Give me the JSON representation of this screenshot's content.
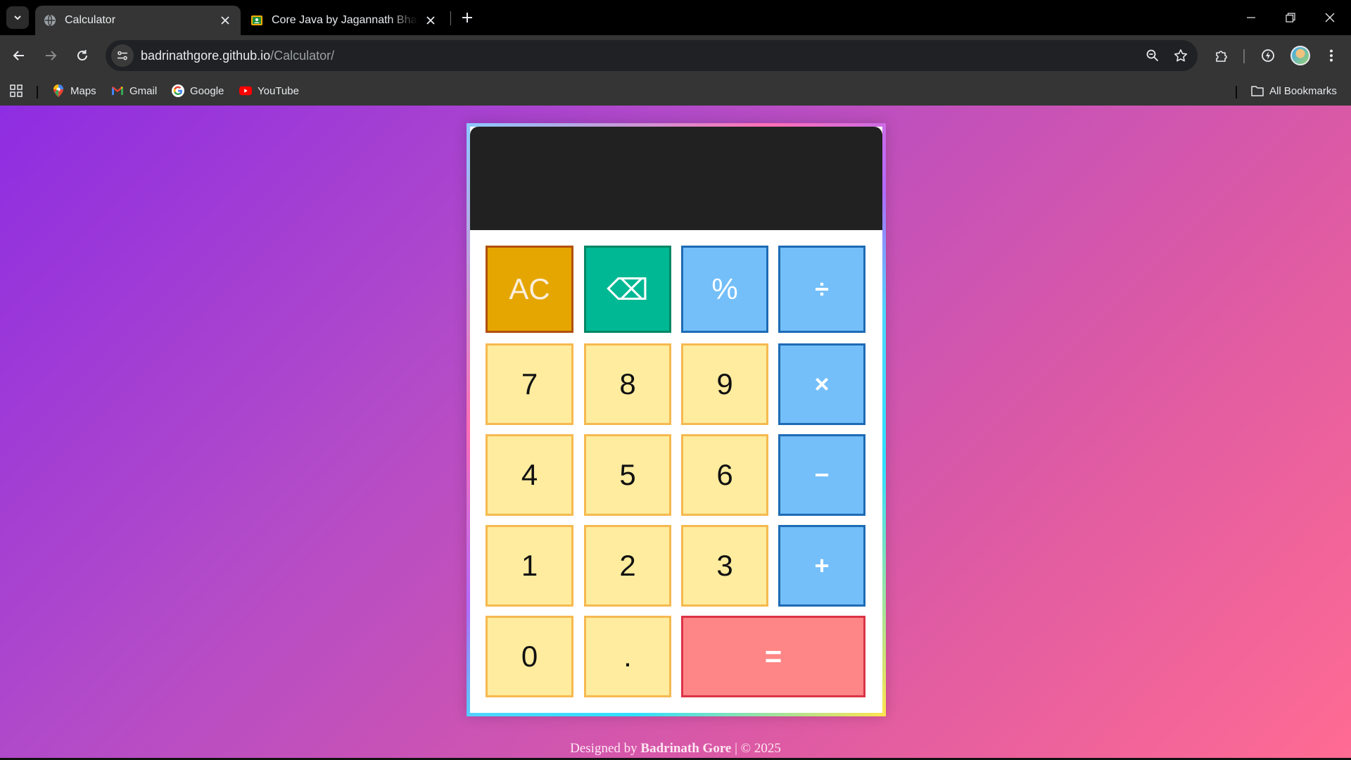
{
  "browser": {
    "tabs": [
      {
        "title": "Calculator",
        "active": true
      },
      {
        "title": "Core Java by Jagannath Bhandari",
        "active": false
      }
    ],
    "url_host": "badrinathgore.github.io",
    "url_path": "/Calculator/",
    "bookmarks": [
      {
        "label": "Maps",
        "icon": "maps-pin-icon"
      },
      {
        "label": "Gmail",
        "icon": "gmail-icon"
      },
      {
        "label": "Google",
        "icon": "google-icon"
      },
      {
        "label": "YouTube",
        "icon": "youtube-icon"
      }
    ],
    "all_bookmarks_label": "All Bookmarks"
  },
  "calculator": {
    "display_value": "",
    "keys": {
      "ac": "AC",
      "backspace": "⌫",
      "percent": "%",
      "divide": "÷",
      "seven": "7",
      "eight": "8",
      "nine": "9",
      "multiply": "×",
      "four": "4",
      "five": "5",
      "six": "6",
      "minus": "−",
      "one": "1",
      "two": "2",
      "three": "3",
      "plus": "+",
      "zero": "0",
      "dot": ".",
      "equals": "="
    },
    "colors": {
      "display": "#212121",
      "number_key": "#ffec9e",
      "operator_key": "#74bff9",
      "clear_key": "#e5a602",
      "backspace_key": "#00b894",
      "equals_key": "#ff8686"
    }
  },
  "footer": {
    "prefix": "Designed by ",
    "author": "Badrinath Gore",
    "suffix": " | © 2025"
  }
}
